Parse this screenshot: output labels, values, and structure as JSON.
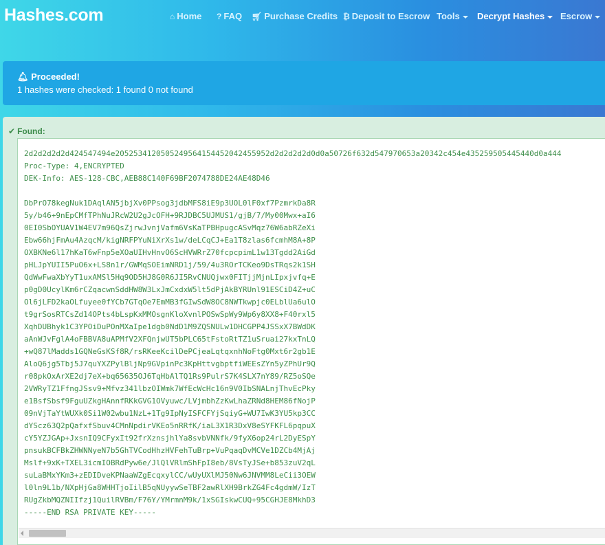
{
  "brand": "Hashes.com",
  "nav": {
    "home": "Home",
    "faq": "FAQ",
    "purchase": "Purchase Credits",
    "deposit": "Deposit to Escrow",
    "tools": "Tools",
    "decrypt": "Decrypt Hashes",
    "escrow": "Escrow"
  },
  "alert": {
    "title": "Proceeded!",
    "body": "1 hashes were checked: 1 found 0 not found"
  },
  "found": {
    "title": "Found:",
    "header_lines": [
      "2d2d2d2d2d424547494e2052534120505249564154452042455952d2d2d2d2d0d0a50726f632d547970653a20342c454e435259505445440d0a444",
      "Proc-Type: 4,ENCRYPTED",
      "DEK-Info: AES-128-CBC,AEB88C140F69BF2074788DE24AE48D46"
    ],
    "key_lines": [
      "DbPrO78kegNuk1DAqlAN5jbjXv0PPsog3jdbMFS8iE9p3UOL0lF0xf7PzmrkDa8R",
      "5y/b46+9nEpCMfTPhNuJRcW2U2gJcOFH+9RJDBC5UJMUS1/gjB/7/My00Mwx+aI6",
      "0EI0SbOYUAV1W4EV7m96QsZjrwJvnjVafm6VsKaTPBHpugcASvMqz76W6abRZeXi",
      "Ebw66hjFmAu4AzqcM/kigNRFPYuNiXrXs1w/deLCqCJ+Ea1T8zlas6fcmhM8A+8P",
      "OXBKNe6l17hKaT6wFnp5eXOaUIHvHnvO6ScHVWRrZ70fcpcpimL1w13Tgdd2AiGd",
      "pHLJpYUII5PuO6x+LS8n1r/GWMqSOEimNRD1j/59/4u3ROrTCKeo9DsTRqs2k1SH",
      "QdWwFwaXbYyT1uxAMSl5Hq9OD5HJ8G0R6JI5RvCNUQjwx0FITjjMjnLIpxjvfq+E",
      "p0gD0UcylKm6rCZqacwnSddHW8W3LxJmCxdxW5lt5dPjAkBYRUnl91ESCiD4Z+uC",
      "Ol6jLFD2kaOLfuyee0fYCb7GTqOe7EmMB3fGIwSdW8OC8NWTkwpjc0ELblUa6ulO",
      "t9grSosRTCsZd14OPts4bLspKxMMOsgnKloXvnlPOSwSpWy9Wp6y8XX8+F40rxl5",
      "XqhDUBhyk1C3YPOiDuPOnMXaIpe1dgb0NdD1M9ZQSNULw1DHCGPP4JSSxX7BWdDK",
      "aAnWJvFglA4oFBBVA8uAPMfV2XFQnjwUT5bPLC65tFstoRtTZ1uSruai27kxTnLQ",
      "+wQ87lMadds1GQNeGsKSf8R/rsRKeeKcilDePCjeaLqtqxnhNoFtg0Mxt6r2gb1E",
      "AloQ6jg5Tbj5J7quYXZPylBljNp9GVpinPc3KpHttvgbptfiWEEsZYn5yZPhUr9Q",
      "r08pkOxArXE2dj7eX+bq65635OJ6TqHbAlTQ1Rs9PulrS7K4SLX7nY89/RZ5oSQe",
      "2VWRyTZ1FfngJSsv9+Mfvz341lbzOIWmk7WfEcWcHc16n9V0IbSNALnjThvEcPky",
      "e1BsfSbsf9FguUZkgHAnnfRKkGVG1OVyuwc/LVjmbhZzKwLhaZRNd8HEM86fNojP",
      "09nVjTaYtWUXk0Si1W02wbu1NzL+1Tg9IpNyISFCFYjSqiyG+WU7IwK3YU5kp3CC",
      "dYScz63Q2pQafxfSbuv4CMnNpdirVKEo5nRRfK/iaL3X1R3DxV8eSYFKFL6pqpuX",
      "cY5YZJGAp+JxsnIQ9CFyxIt92frXznsjhlYa8svbVNNfk/9fyX6op24rL2DyESpY",
      "pnsukBCFBkZHWNNyeN7b5GhTVCodHhzHVFehTuBrp+VuPqaqDvMCVe1DZCb4MjAj",
      "Mslf+9xK+TXEL3icmIOBRdPyw6e/JlQlVRlmShFpI8eb/8VsTyJSe+b853zuV2qL",
      "suLaBMxYKm3+zEDIDveKPNaaWZgEcqxylCC/wUyUXlMJ50Nw6JNVMM8LeCii3OEW",
      "l0ln9L1b/NXpHjGa8WHHTjoIilB5qNUyywSeTBF2awRlXH9BrkZG4Fc4gdmW/IzT",
      "RUgZkbMQZNIIfzj1QuilRVBm/F76Y/YMrmnM9k/1xSGIskwCUQ+95CGHJE8MkhD3",
      "-----END RSA PRIVATE KEY-----"
    ]
  },
  "icons": {
    "home": "home-icon",
    "faq": "question-icon",
    "purchase": "cart-icon",
    "deposit": "bitcoin-icon",
    "alert": "bell-icon",
    "found": "check-icon"
  },
  "colors": {
    "alert_bg": "#1fa6e4",
    "panel_bg": "#d8eee0",
    "success_text": "#3c8b4a",
    "code_text": "#3e8e4a"
  }
}
